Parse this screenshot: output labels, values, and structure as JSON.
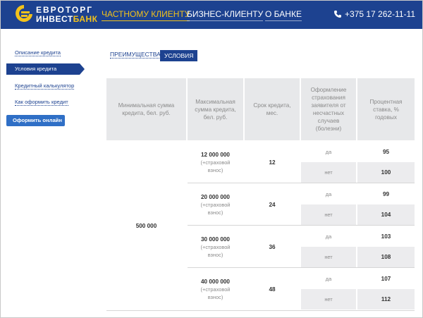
{
  "header": {
    "logo": {
      "line1": "ЕВРОТОРГ",
      "line2_a": "ИНВЕСТ",
      "line2_b": "БАНК"
    },
    "nav": [
      {
        "label": "ЧАСТНОМУ КЛИЕНТУ",
        "active": true
      },
      {
        "label": "БИЗНЕС-КЛИЕНТУ",
        "active": false
      },
      {
        "label": "О БАНКЕ",
        "active": false
      }
    ],
    "phone": "+375 17 262-11-11",
    "colors": {
      "bar": "#1d4290",
      "accent": "#f2c21b"
    }
  },
  "sidebar": {
    "items": [
      {
        "label": "Описание кредита"
      },
      {
        "label": "Условия кредита",
        "active": true
      },
      {
        "label": "Кредитный калькулятор"
      },
      {
        "label": "Как оформить кредит"
      }
    ],
    "online_button": "Оформить онлайн"
  },
  "tabs": [
    {
      "label": "ПРЕИМУЩЕСТВА",
      "active": false
    },
    {
      "label": "УСЛОВИЯ",
      "active": true
    }
  ],
  "table": {
    "headers": [
      "Минимальная сумма кредита, бел. руб.",
      "Максимальная сумма кредита, бел. руб.",
      "Срок кредита, мес.",
      "Оформление страхования заявителя от несчастных случаев (болезни)",
      "Процентная ставка, % годовых"
    ],
    "min_amount": "500 000",
    "insurance_note": "(+страховой взнос)",
    "groups": [
      {
        "max_amount": "12 000 000",
        "term": "12",
        "rows": [
          {
            "insurance": "да",
            "rate": "95"
          },
          {
            "insurance": "нет",
            "rate": "100"
          }
        ]
      },
      {
        "max_amount": "20 000 000",
        "term": "24",
        "rows": [
          {
            "insurance": "да",
            "rate": "99"
          },
          {
            "insurance": "нет",
            "rate": "104"
          }
        ]
      },
      {
        "max_amount": "30 000 000",
        "term": "36",
        "rows": [
          {
            "insurance": "да",
            "rate": "103"
          },
          {
            "insurance": "нет",
            "rate": "108"
          }
        ]
      },
      {
        "max_amount": "40 000 000",
        "term": "48",
        "rows": [
          {
            "insurance": "да",
            "rate": "107"
          },
          {
            "insurance": "нет",
            "rate": "112"
          }
        ]
      }
    ]
  }
}
